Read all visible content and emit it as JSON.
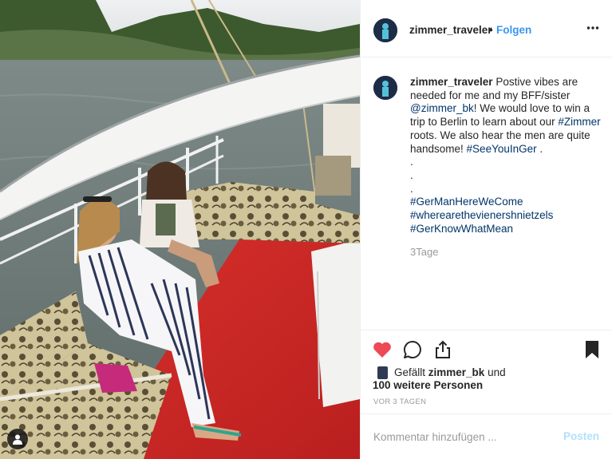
{
  "post": {
    "username": "zimmer_traveler",
    "dot": "•",
    "follow_label": "Folgen",
    "more_icon": "more-horizontal-icon"
  },
  "caption": {
    "username": "zimmer_traveler",
    "text_1": " Postive vibes are needed for me and my BFF/sister ",
    "mention": "@zimmer_bk",
    "text_2": "! We would love to win a trip to Berlin to learn about our ",
    "tag_zimmer": "#Zimmer",
    "text_3": " roots. We also hear the men are quite handsome! ",
    "tag_seeyou": "#SeeYouInGer",
    "text_4": " .",
    "dots": [
      ".",
      ".",
      "."
    ],
    "hashtags": [
      "#GerManHereWeCome",
      "#wherearethevienershnietzels",
      "#GerKnowWhatMean"
    ],
    "time": "3Tage"
  },
  "likes": {
    "prefix": "Gefällt ",
    "liker": "zimmer_bk",
    "and": " und",
    "others": "100 weitere Personen",
    "date": "VOR 3 TAGEN"
  },
  "comment_box": {
    "placeholder": "Kommentar hinzufügen ...",
    "post_label": "Posten"
  },
  "colors": {
    "heart": "#ed4956",
    "link": "#003569",
    "follow": "#3897f0",
    "muted": "#999999"
  },
  "icons": [
    "heart-icon",
    "comment-icon",
    "share-icon",
    "bookmark-icon",
    "user-tag-icon"
  ]
}
